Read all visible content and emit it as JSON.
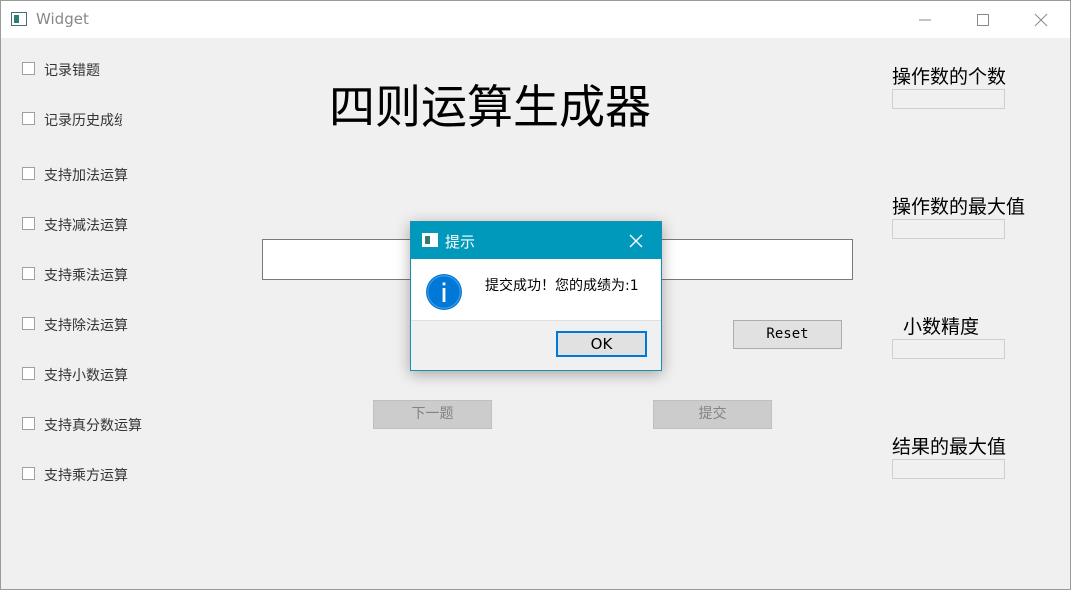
{
  "window": {
    "title": "Widget"
  },
  "options": [
    {
      "label": "记录错题",
      "checked": false
    },
    {
      "label": "记录历史成绩",
      "checked": false
    },
    {
      "label": "支持加法运算",
      "checked": false
    },
    {
      "label": "支持减法运算",
      "checked": false
    },
    {
      "label": "支持乘法运算",
      "checked": false
    },
    {
      "label": "支持除法运算",
      "checked": false
    },
    {
      "label": "支持小数运算",
      "checked": false
    },
    {
      "label": "支持真分数运算",
      "checked": false
    },
    {
      "label": "支持乘方运算",
      "checked": false
    }
  ],
  "main": {
    "title": "四则运算生成器",
    "expression_value": "",
    "reset_label": "Reset",
    "next_label": "下一题",
    "submit_label": "提交"
  },
  "settings": {
    "operand_count_label": "操作数的个数",
    "operand_count_value": "",
    "operand_max_label": "操作数的最大值",
    "operand_max_value": "",
    "decimal_precision_label": "小数精度",
    "decimal_precision_value": "",
    "result_max_label": "结果的最大值",
    "result_max_value": ""
  },
  "dialog": {
    "title": "提示",
    "message": "提交成功！您的成绩为:1",
    "ok_label": "OK",
    "icon": "info-icon"
  },
  "colors": {
    "dialog_titlebar": "#0099bc",
    "info_icon": "#0078d7",
    "ok_focus_border": "#0078d7"
  }
}
